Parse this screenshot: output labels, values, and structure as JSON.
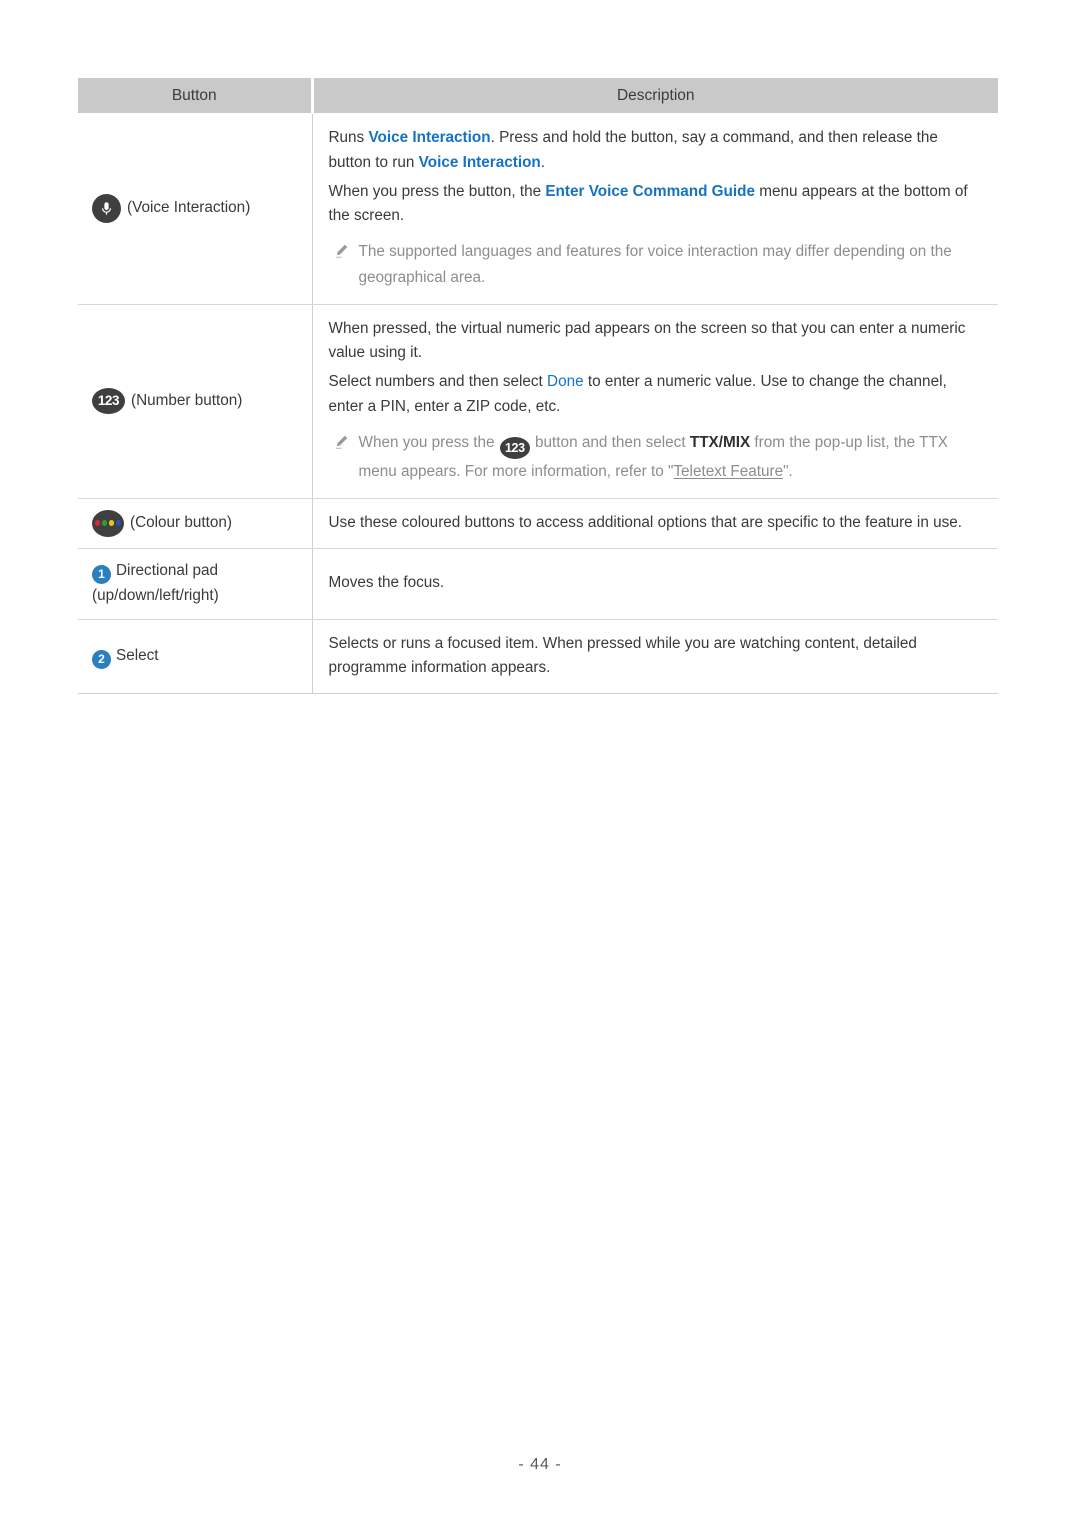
{
  "page": {
    "page_number": "- 44 -"
  },
  "table": {
    "headers": {
      "button": "Button",
      "description": "Description"
    },
    "rows": [
      {
        "icon": "microphone-icon",
        "button_label": "(Voice Interaction)",
        "paragraphs": {
          "p1_a": "Runs ",
          "p1_link1": "Voice Interaction",
          "p1_b": ". Press and hold the button, say a command, and then release the button to run ",
          "p1_link2": "Voice Interaction",
          "p1_c": ".",
          "p2_a": "When you press the button, the ",
          "p2_link": "Enter Voice Command Guide",
          "p2_b": " menu appears at the bottom of the screen.",
          "note": "The supported languages and features for voice interaction may differ depending on the geographical area."
        }
      },
      {
        "icon": "number-123-icon",
        "icon_text": "123",
        "button_label": "(Number button)",
        "paragraphs": {
          "p1": "When pressed, the virtual numeric pad appears on the screen so that you can enter a numeric value using it.",
          "p2_a": "Select numbers and then select ",
          "p2_link": "Done",
          "p2_b": " to enter a numeric value. Use to change the channel, enter a PIN, enter a ZIP code, etc.",
          "note_a": "When you press the ",
          "note_icon_text": "123",
          "note_b": " button and then select ",
          "note_bold": "TTX/MIX",
          "note_c": " from the pop-up list, the TTX menu appears. For more information, refer to \"",
          "note_underline": "Teletext Feature",
          "note_d": "\"."
        }
      },
      {
        "icon": "colour-buttons-icon",
        "button_label": "(Colour button)",
        "paragraphs": {
          "p1": "Use these coloured buttons to access additional options that are specific to the feature in use."
        }
      },
      {
        "icon": "badge-1-icon",
        "badge_text": "1",
        "button_label": "Directional pad (up/down/left/right)",
        "paragraphs": {
          "p1": "Moves the focus."
        }
      },
      {
        "icon": "badge-2-icon",
        "badge_text": "2",
        "button_label": "Select",
        "paragraphs": {
          "p1": "Selects or runs a focused item. When pressed while you are watching content, detailed programme information appears."
        }
      }
    ]
  },
  "colors": {
    "link_blue": "#1673c4",
    "badge_blue": "#2a7fbf",
    "icon_dark": "#3f3f3f",
    "header_grey": "#c9c9c9",
    "note_grey": "#8d8d8d",
    "dot_red": "#d42b2b",
    "dot_green": "#2c9c3a",
    "dot_yellow": "#e5c41f",
    "dot_blue": "#2a4fb5"
  }
}
